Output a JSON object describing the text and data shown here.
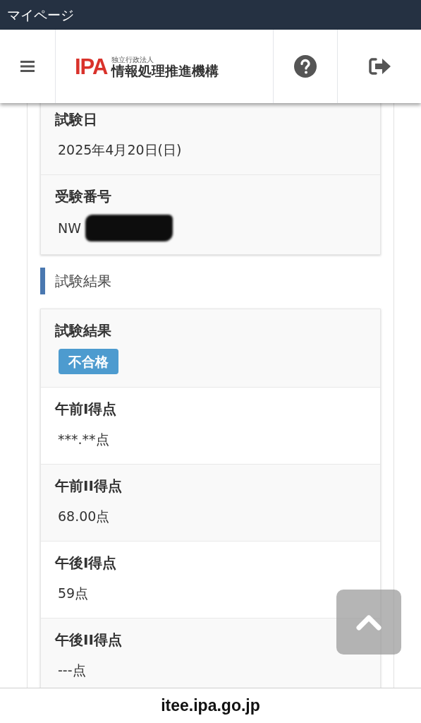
{
  "title_bar": {
    "title": "マイページ"
  },
  "header": {
    "logo": {
      "mark": "IPA",
      "subtitle": "独立行政法人",
      "name": "情報処理推進機構"
    }
  },
  "exam_info": {
    "rows": [
      {
        "label": "試験日",
        "value": "2025年4月20日(日)",
        "kind": "text"
      },
      {
        "label": "受験番号",
        "value": "NW",
        "kind": "redacted"
      }
    ]
  },
  "results_section": {
    "heading": "試験結果",
    "rows": [
      {
        "label": "試験結果",
        "value": "不合格",
        "kind": "badge"
      },
      {
        "label": "午前I得点",
        "value": "***.**点",
        "kind": "text"
      },
      {
        "label": "午前II得点",
        "value": "68.00点",
        "kind": "text"
      },
      {
        "label": "午後I得点",
        "value": "59点",
        "kind": "text"
      },
      {
        "label": "午後II得点",
        "value": "---点",
        "kind": "text"
      }
    ]
  },
  "footer": {
    "url": "itee.ipa.go.jp"
  }
}
